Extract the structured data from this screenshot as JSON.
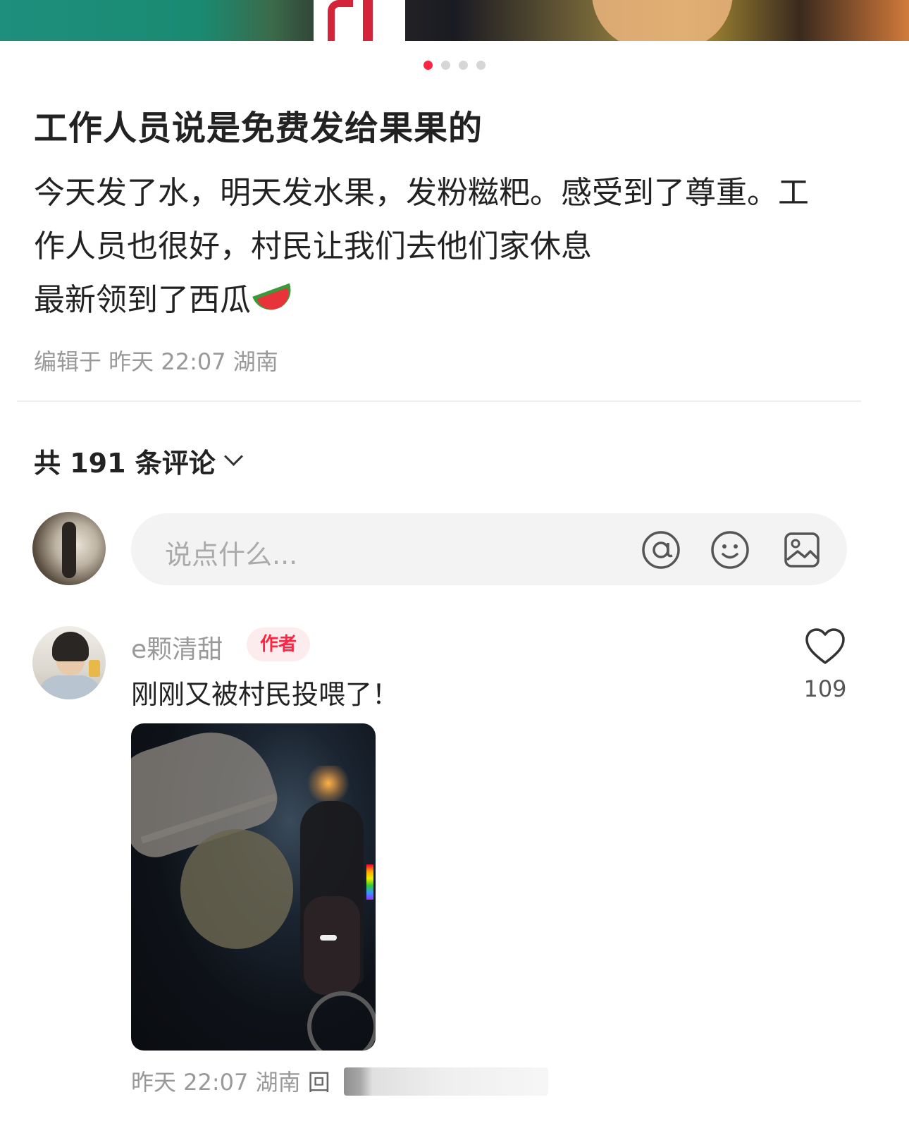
{
  "carousel": {
    "total": 4,
    "active": 0,
    "colors": {
      "active": "#ff2442",
      "inactive": "#d6d6d6"
    }
  },
  "post": {
    "title": "工作人员说是免费发给果果的",
    "body_lines": [
      "今天发了水，明天发水果，发粉糍粑。感受到了尊重。工",
      "作人员也很好，村民让我们去他们家休息",
      "最新领到了西瓜"
    ],
    "emoji": "watermelon-icon",
    "edited": "编辑于 昨天 22:07 湖南"
  },
  "comments": {
    "count_label": "共 191 条评论",
    "input": {
      "placeholder": "说点什么...",
      "icons": [
        "at-icon",
        "emoji-icon",
        "image-icon"
      ]
    },
    "items": [
      {
        "author": "e颗清甜",
        "badge": "作者",
        "text": "刚刚又被村民投喂了！",
        "likes": "109",
        "meta": "昨天 22:07 湖南",
        "reply": "回"
      }
    ]
  },
  "accent": "#ff2442"
}
